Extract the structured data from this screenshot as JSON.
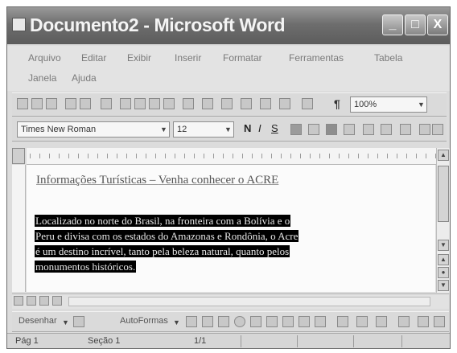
{
  "window": {
    "title": "Documento2 - Microsoft Word",
    "minimize": "_",
    "maximize": "□",
    "close": "X"
  },
  "menu": [
    "Arquivo",
    "Editar",
    "Exibir",
    "Inserir",
    "Formatar",
    "Ferramentas",
    "Tabela",
    "Janela",
    "Ajuda"
  ],
  "standard_toolbar": {
    "zoom": "100%",
    "pilcrow": "¶"
  },
  "formatting_toolbar": {
    "font": "Times New Roman",
    "size": "12",
    "bold": "N",
    "italic": "I",
    "underline": "S"
  },
  "document": {
    "heading_prefix": "Informações Turísticas – ",
    "heading_link": "Venha conhecer o ACRE",
    "paragraph_lines": [
      "Localizado no norte do Brasil, na fronteira com a Bolívia e o",
      "Peru e divisa com os estados do Amazonas e Rondônia, o Acre",
      "é um destino incrível, tanto pela beleza natural, quanto pelos",
      "monumentos históricos."
    ]
  },
  "drawing_toolbar": {
    "draw": "Desenhar",
    "autoshapes": "AutoFormas"
  },
  "status_bar": {
    "page": "Pág 1",
    "section": "Seção 1",
    "pages": "1/1"
  },
  "colors": {
    "title_bar": "#6e6e6e",
    "selection": "#000000"
  }
}
